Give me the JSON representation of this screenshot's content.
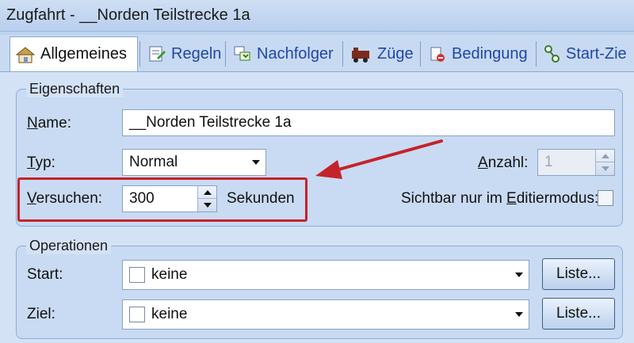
{
  "window": {
    "title": "Zugfahrt - __Norden Teilstrecke 1a"
  },
  "tabs": [
    {
      "label": "Allgemeines",
      "icon": "house-icon"
    },
    {
      "label": "Regeln",
      "icon": "rules-icon"
    },
    {
      "label": "Nachfolger",
      "icon": "successor-icon"
    },
    {
      "label": "Züge",
      "icon": "train-icon"
    },
    {
      "label": "Bedingung",
      "icon": "condition-icon"
    },
    {
      "label": "Start-Zie",
      "icon": "start-target-icon"
    }
  ],
  "eigenschaften": {
    "legend": "Eigenschaften",
    "name_label": "Name:",
    "name_value": "__Norden Teilstrecke 1a",
    "typ_label": "Typ:",
    "typ_value": "Normal",
    "anzahl_label": "Anzahl:",
    "anzahl_value": "1",
    "versuchen_label": "Versuchen:",
    "versuchen_value": "300",
    "sekunden_label": "Sekunden",
    "sichtbar_label": "Sichtbar nur im Editiermodus:"
  },
  "operationen": {
    "legend": "Operationen",
    "start_label": "Start:",
    "start_value": "keine",
    "ziel_label": "Ziel:",
    "ziel_value": "keine",
    "liste_label": "Liste..."
  },
  "colors": {
    "annotation": "#c4232b",
    "link_tab": "#1f47a8"
  }
}
